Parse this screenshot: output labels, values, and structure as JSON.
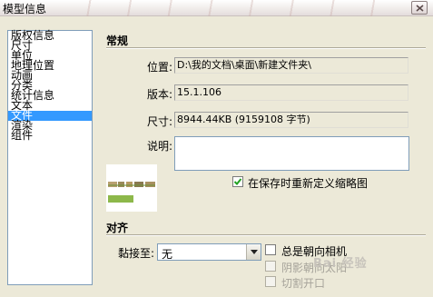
{
  "window": {
    "title": "模型信息"
  },
  "nav": {
    "items": [
      {
        "label": "版权信息",
        "selected": false
      },
      {
        "label": "尺寸",
        "selected": false
      },
      {
        "label": "单位",
        "selected": false
      },
      {
        "label": "地理位置",
        "selected": false
      },
      {
        "label": "动画",
        "selected": false
      },
      {
        "label": "分类",
        "selected": false
      },
      {
        "label": "统计信息",
        "selected": false
      },
      {
        "label": "文本",
        "selected": false
      },
      {
        "label": "文件",
        "selected": true
      },
      {
        "label": "渲染",
        "selected": false
      },
      {
        "label": "组件",
        "selected": false
      }
    ]
  },
  "general": {
    "section_title": "常规",
    "location_label": "位置:",
    "location_value": "D:\\我的文档\\桌面\\新建文件夹\\",
    "version_label": "版本:",
    "version_value": "15.1.106",
    "size_label": "尺寸:",
    "size_value": "8944.44KB (9159108 字节)",
    "description_label": "说明:",
    "description_value": "",
    "redefine_thumbnail_label": "在保存时重新定义缩略图",
    "redefine_thumbnail_checked": true
  },
  "align": {
    "section_title": "对齐",
    "glue_label": "黏接至:",
    "glue_value": "无",
    "always_face_camera_label": "总是朝向相机",
    "shadows_face_sun_label": "阴影朝向太阳",
    "cut_opening_label": "切割开口"
  },
  "colors": {
    "selection": "#3399ff",
    "dialog_bg": "#ece9d8",
    "thumb_green": "#8db84a"
  },
  "icons": {
    "close": "close-icon",
    "dropdown": "chevron-down-icon",
    "check": "checkmark-icon"
  },
  "watermark": "Bai 经验"
}
